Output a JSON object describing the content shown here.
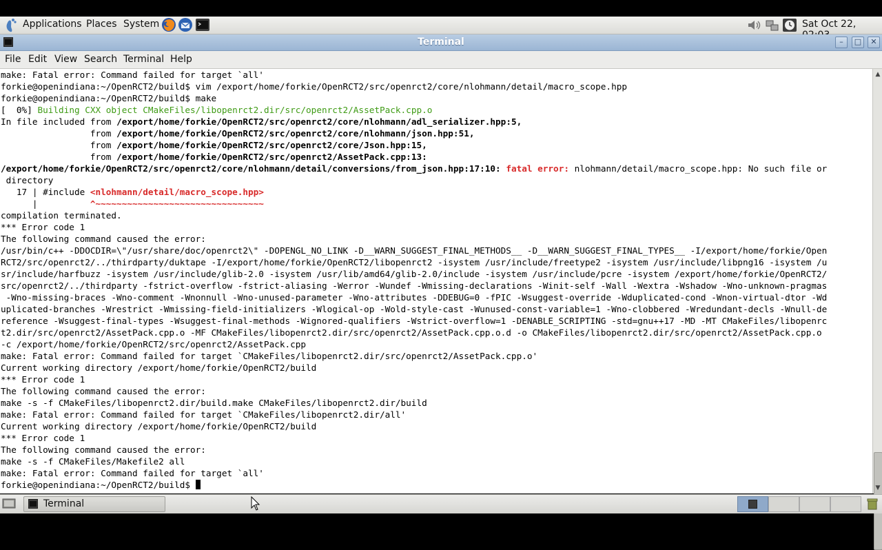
{
  "top_panel": {
    "applications": "Applications",
    "places": "Places",
    "system": "System",
    "clock": "Sat Oct 22, 02:03"
  },
  "window": {
    "title": "Terminal"
  },
  "menubar": {
    "file": "File",
    "edit": "Edit",
    "view": "View",
    "search": "Search",
    "terminal": "Terminal",
    "help": "Help"
  },
  "terminal_lines": [
    "make: Fatal error: Command failed for target `all'",
    "forkie@openindiana:~/OpenRCT2/build$ vim /export/home/forkie/OpenRCT2/src/openrct2/core/nlohmann/detail/macro_scope.hpp",
    "forkie@openindiana:~/OpenRCT2/build$ make",
    "[  0%] ",
    "Building CXX object CMakeFiles/libopenrct2.dir/src/openrct2/AssetPack.cpp.o",
    "In file included from ",
    "/export/home/forkie/OpenRCT2/src/openrct2/core/nlohmann/adl_serializer.hpp:5,",
    "                 from ",
    "/export/home/forkie/OpenRCT2/src/openrct2/core/nlohmann/json.hpp:51,",
    "/export/home/forkie/OpenRCT2/src/openrct2/core/Json.hpp:15,",
    "/export/home/forkie/OpenRCT2/src/openrct2/AssetPack.cpp:13:",
    "/export/home/forkie/OpenRCT2/src/openrct2/core/nlohmann/detail/conversions/from_json.hpp:17:10: ",
    "fatal error: ",
    "nlohmann/detail/macro_scope.hpp: No such file or",
    " directory",
    "   17 | #include ",
    "<nlohmann/detail/macro_scope.hpp>",
    "      |          ",
    "^~~~~~~~~~~~~~~~~~~~~~~~~~~~~~~~~",
    "compilation terminated.",
    "*** Error code 1",
    "The following command caused the error:",
    "/usr/bin/c++ -DDOCDIR=\\\"/usr/share/doc/openrct2\\\" -DOPENGL_NO_LINK -D__WARN_SUGGEST_FINAL_METHODS__ -D__WARN_SUGGEST_FINAL_TYPES__ -I/export/home/forkie/Open",
    "RCT2/src/openrct2/../thirdparty/duktape -I/export/home/forkie/OpenRCT2/libopenrct2 -isystem /usr/include/freetype2 -isystem /usr/include/libpng16 -isystem /u",
    "sr/include/harfbuzz -isystem /usr/include/glib-2.0 -isystem /usr/lib/amd64/glib-2.0/include -isystem /usr/include/pcre -isystem /export/home/forkie/OpenRCT2/",
    "src/openrct2/../thirdparty -fstrict-overflow -fstrict-aliasing -Werror -Wundef -Wmissing-declarations -Winit-self -Wall -Wextra -Wshadow -Wno-unknown-pragmas",
    " -Wno-missing-braces -Wno-comment -Wnonnull -Wno-unused-parameter -Wno-attributes -DDEBUG=0 -fPIC -Wsuggest-override -Wduplicated-cond -Wnon-virtual-dtor -Wd",
    "uplicated-branches -Wrestrict -Wmissing-field-initializers -Wlogical-op -Wold-style-cast -Wunused-const-variable=1 -Wno-clobbered -Wredundant-decls -Wnull-de",
    "reference -Wsuggest-final-types -Wsuggest-final-methods -Wignored-qualifiers -Wstrict-overflow=1 -DENABLE_SCRIPTING -std=gnu++17 -MD -MT CMakeFiles/libopenrc",
    "t2.dir/src/openrct2/AssetPack.cpp.o -MF CMakeFiles/libopenrct2.dir/src/openrct2/AssetPack.cpp.o.d -o CMakeFiles/libopenrct2.dir/src/openrct2/AssetPack.cpp.o",
    "-c /export/home/forkie/OpenRCT2/src/openrct2/AssetPack.cpp",
    "make: Fatal error: Command failed for target `CMakeFiles/libopenrct2.dir/src/openrct2/AssetPack.cpp.o'",
    "Current working directory /export/home/forkie/OpenRCT2/build",
    "*** Error code 1",
    "The following command caused the error:",
    "make -s -f CMakeFiles/libopenrct2.dir/build.make CMakeFiles/libopenrct2.dir/build",
    "make: Fatal error: Command failed for target `CMakeFiles/libopenrct2.dir/all'",
    "Current working directory /export/home/forkie/OpenRCT2/build",
    "*** Error code 1",
    "The following command caused the error:",
    "make -s -f CMakeFiles/Makefile2 all",
    "make: Fatal error: Command failed for target `all'",
    "forkie@openindiana:~/OpenRCT2/build$ "
  ],
  "taskbar": {
    "terminal": "Terminal"
  }
}
